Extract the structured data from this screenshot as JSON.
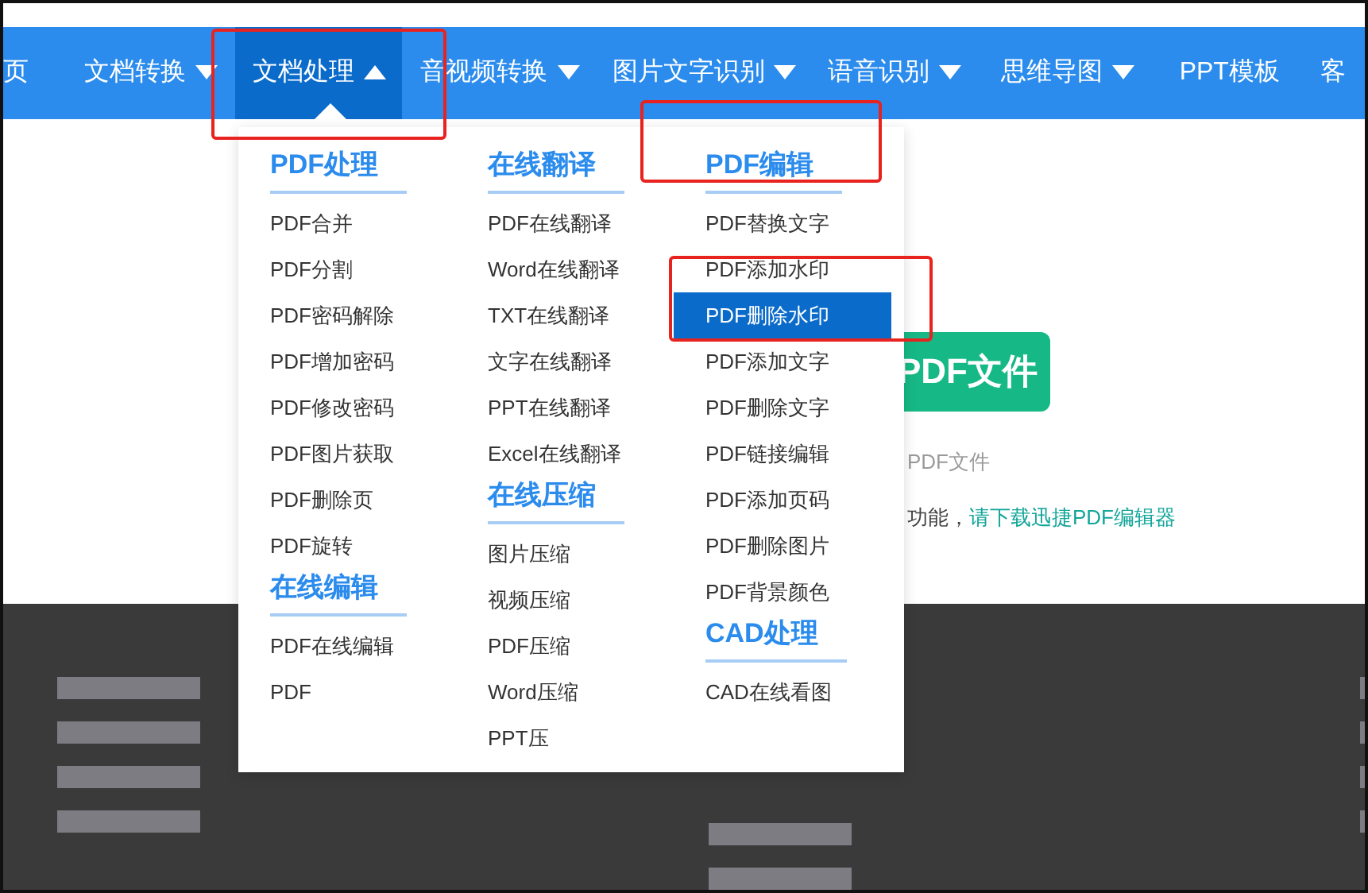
{
  "nav": {
    "items": [
      {
        "label": "页",
        "caret": false,
        "selected": false
      },
      {
        "label": "文档转换",
        "caret": true,
        "selected": false
      },
      {
        "label": "文档处理",
        "caret": true,
        "selected": true
      },
      {
        "label": "音视频转换",
        "caret": true,
        "selected": false
      },
      {
        "label": "图片文字识别",
        "caret": true,
        "selected": false
      },
      {
        "label": "语音识别",
        "caret": true,
        "selected": false
      },
      {
        "label": "思维导图",
        "caret": true,
        "selected": false
      },
      {
        "label": "PPT模板",
        "caret": false,
        "selected": false
      },
      {
        "label": "客",
        "caret": false,
        "selected": false
      }
    ]
  },
  "menu": {
    "columns": [
      {
        "sections": [
          {
            "heading": "PDF处理",
            "items": [
              {
                "label": "PDF合并",
                "selected": false
              },
              {
                "label": "PDF分割",
                "selected": false
              },
              {
                "label": "PDF密码解除",
                "selected": false
              },
              {
                "label": "PDF增加密码",
                "selected": false
              },
              {
                "label": "PDF修改密码",
                "selected": false
              },
              {
                "label": "PDF图片获取",
                "selected": false
              },
              {
                "label": "PDF删除页",
                "selected": false
              },
              {
                "label": "PDF旋转",
                "selected": false
              }
            ]
          },
          {
            "heading": "在线编辑",
            "items": [
              {
                "label": "PDF在线编辑",
                "selected": false
              },
              {
                "label": "PDF",
                "selected": false
              }
            ]
          }
        ]
      },
      {
        "sections": [
          {
            "heading": "在线翻译",
            "items": [
              {
                "label": "PDF在线翻译",
                "selected": false
              },
              {
                "label": "Word在线翻译",
                "selected": false
              },
              {
                "label": "TXT在线翻译",
                "selected": false
              },
              {
                "label": "文字在线翻译",
                "selected": false
              },
              {
                "label": "PPT在线翻译",
                "selected": false
              },
              {
                "label": "Excel在线翻译",
                "selected": false
              }
            ]
          },
          {
            "heading": "在线压缩",
            "items": [
              {
                "label": "图片压缩",
                "selected": false
              },
              {
                "label": "视频压缩",
                "selected": false
              },
              {
                "label": "PDF压缩",
                "selected": false
              },
              {
                "label": "Word压缩",
                "selected": false
              },
              {
                "label": "PPT压",
                "selected": false
              }
            ]
          }
        ]
      },
      {
        "sections": [
          {
            "heading": "PDF编辑",
            "items": [
              {
                "label": "PDF替换文字",
                "selected": false
              },
              {
                "label": "PDF添加水印",
                "selected": false
              },
              {
                "label": "PDF删除水印",
                "selected": true
              },
              {
                "label": "PDF添加文字",
                "selected": false
              },
              {
                "label": "PDF删除文字",
                "selected": false
              },
              {
                "label": "PDF链接编辑",
                "selected": false
              },
              {
                "label": "PDF添加页码",
                "selected": false
              },
              {
                "label": "PDF删除图片",
                "selected": false
              },
              {
                "label": "PDF背景颜色",
                "selected": false
              }
            ]
          },
          {
            "heading": "CAD处理",
            "items": [
              {
                "label": "CAD在线看图",
                "selected": false
              }
            ]
          }
        ]
      }
    ]
  },
  "page": {
    "button": "PDF文件",
    "note": "PDF文件",
    "line_text": "功能，",
    "line_link": "请下载迅捷PDF编辑器"
  }
}
